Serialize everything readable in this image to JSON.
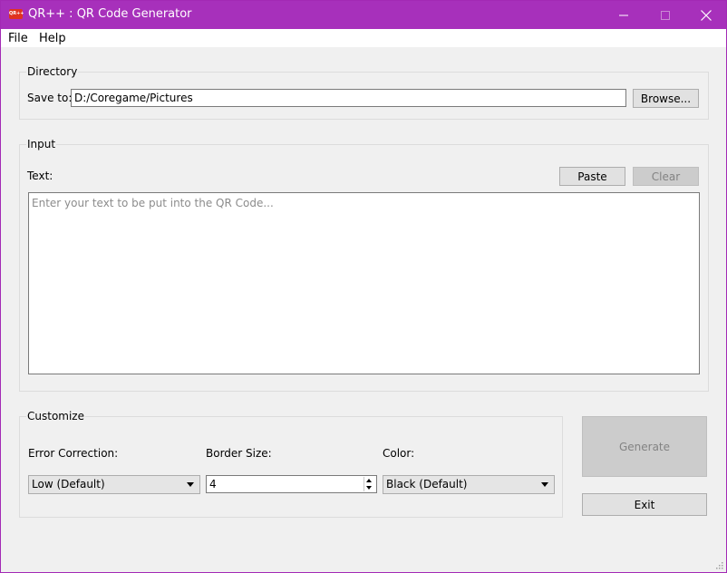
{
  "window": {
    "app_icon_text": "QR++",
    "title": "QR++ : QR Code Generator",
    "accent_color": "#a730bb"
  },
  "menu": {
    "items": [
      {
        "label": "File"
      },
      {
        "label": "Help"
      }
    ]
  },
  "directory": {
    "group_title": "Directory",
    "save_to_label": "Save to:",
    "save_to_value": "D:/Coregame/Pictures",
    "browse_label": "Browse..."
  },
  "input": {
    "group_title": "Input",
    "text_label": "Text:",
    "paste_label": "Paste",
    "clear_label": "Clear",
    "text_placeholder": "Enter your text to be put into the QR Code...",
    "text_value": ""
  },
  "customize": {
    "group_title": "Customize",
    "error_correction_label": "Error Correction:",
    "error_correction_value": "Low (Default)",
    "border_size_label": "Border Size:",
    "border_size_value": "4",
    "color_label": "Color:",
    "color_value": "Black (Default)"
  },
  "actions": {
    "generate_label": "Generate",
    "exit_label": "Exit"
  }
}
